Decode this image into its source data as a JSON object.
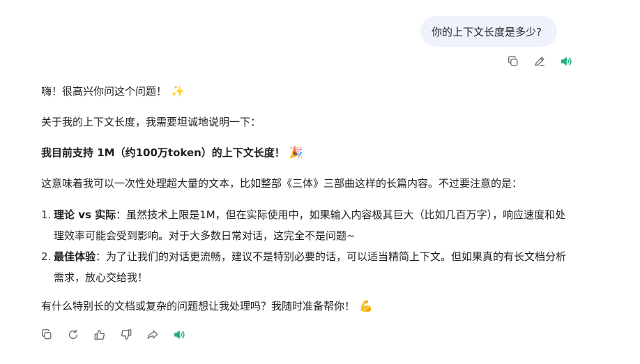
{
  "user_message": {
    "text": "你的上下文长度是多少?"
  },
  "user_actions": {
    "copy_icon": "copy-icon",
    "edit_icon": "pencil-icon",
    "speak_icon": "speaker-icon"
  },
  "reply": {
    "greeting": "嗨！很高兴你问这个问题！",
    "greeting_emoji": "✨",
    "intro": "关于我的上下文长度，我需要坦诚地说明一下：",
    "headline": "我目前支持 1M（约100万token）的上下文长度！",
    "headline_emoji": "🎉",
    "explanation": "这意味着我可以一次性处理超大量的文本，比如整部《三体》三部曲这样的长篇内容。不过要注意的是：",
    "points": [
      {
        "number": "1.",
        "title": "理论 vs 实际",
        "body": "：虽然技术上限是1M，但在实际使用中，如果输入内容极其巨大（比如几百万字），响应速度和处理效率可能会受到影响。对于大多数日常对话，这完全不是问题~"
      },
      {
        "number": "2.",
        "title": "最佳体验",
        "body": "：为了让我们的对话更流畅，建议不是特别必要的话，可以适当精简上下文。但如果真的有长文档分析需求，放心交给我！"
      }
    ],
    "closing": "有什么特别长的文档或复杂的问题想让我处理吗？我随时准备帮你！",
    "closing_emoji": "💪"
  },
  "reply_actions": {
    "copy_icon": "copy-icon",
    "regenerate_icon": "refresh-icon",
    "like_icon": "thumbs-up-icon",
    "dislike_icon": "thumbs-down-icon",
    "share_icon": "share-icon",
    "speak_icon": "speaker-icon"
  },
  "colors": {
    "user_bubble_bg": "#eef2fb",
    "icon_gray": "#6b6b6b",
    "speaker_accent": "#1fb079"
  }
}
